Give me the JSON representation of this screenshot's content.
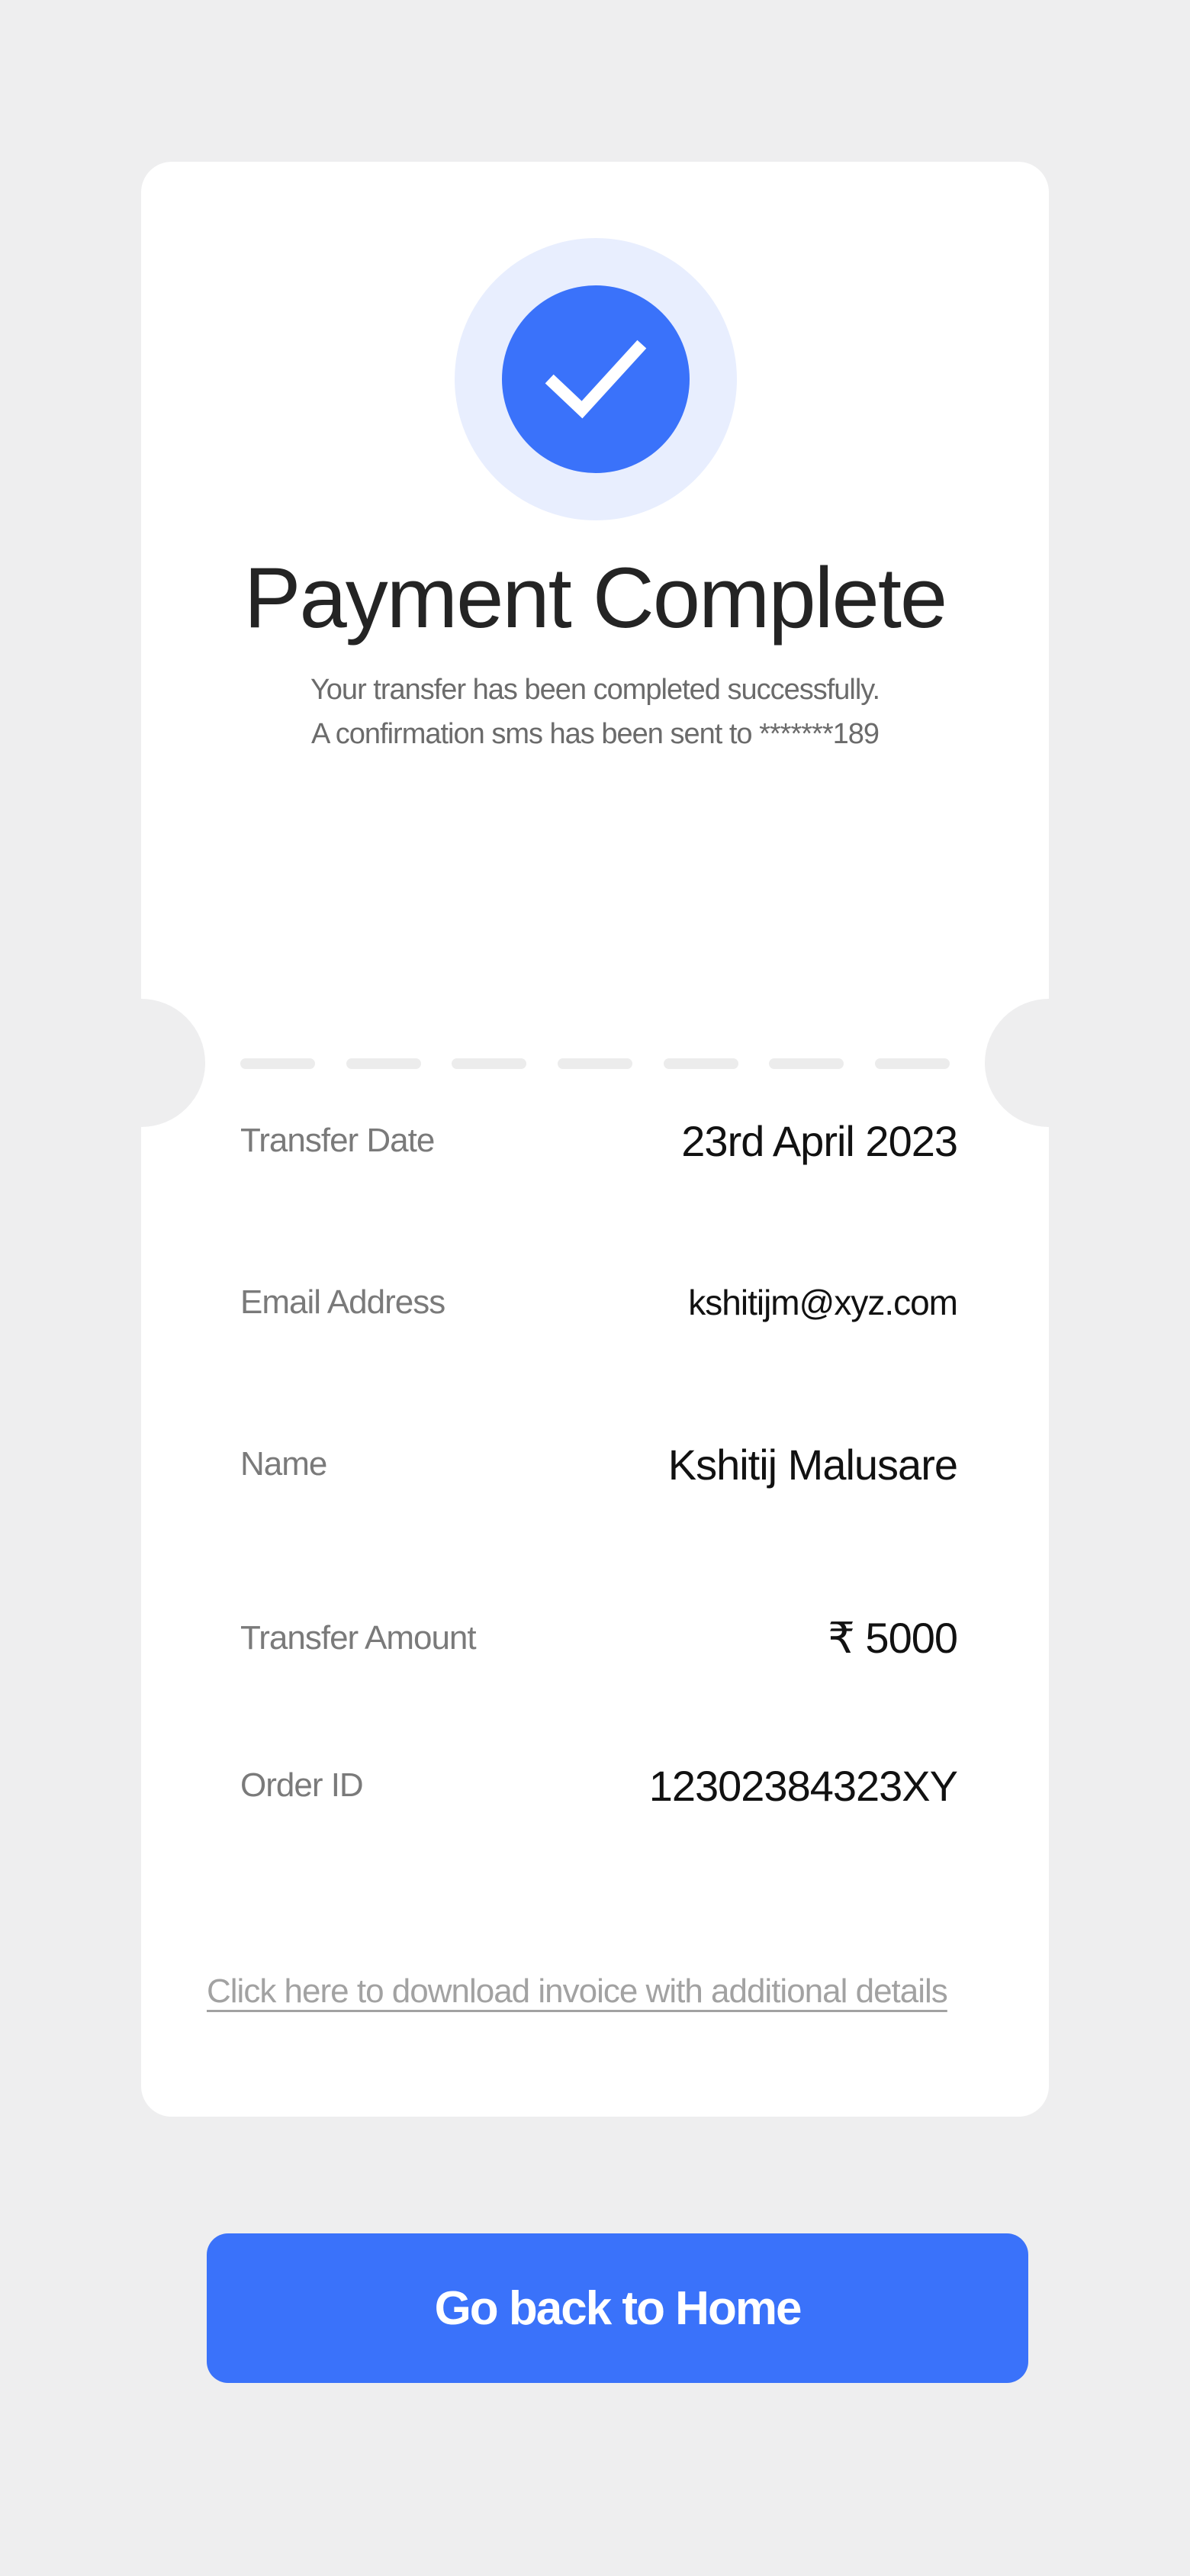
{
  "header": {
    "title": "Payment Complete",
    "subtitle_line1": "Your transfer has been completed successfully.",
    "subtitle_line2": "A confirmation sms has been sent to *******189"
  },
  "icons": {
    "status": "check-icon"
  },
  "details": [
    {
      "label": "Transfer Date",
      "value": "23rd April 2023"
    },
    {
      "label": "Email Address",
      "value": "kshitijm@xyz.com"
    },
    {
      "label": "Name",
      "value": "Kshitij Malusare"
    },
    {
      "label": "Transfer Amount",
      "value": "₹ 5000"
    },
    {
      "label": "Order ID",
      "value": "12302384323XY"
    }
  ],
  "links": {
    "download_invoice": "Click here to download invoice with additional details"
  },
  "buttons": {
    "home": "Go back to Home"
  },
  "colors": {
    "accent": "#3a72fa",
    "accent_light": "#e8eefe",
    "background": "#eeeeef",
    "card": "#ffffff"
  }
}
